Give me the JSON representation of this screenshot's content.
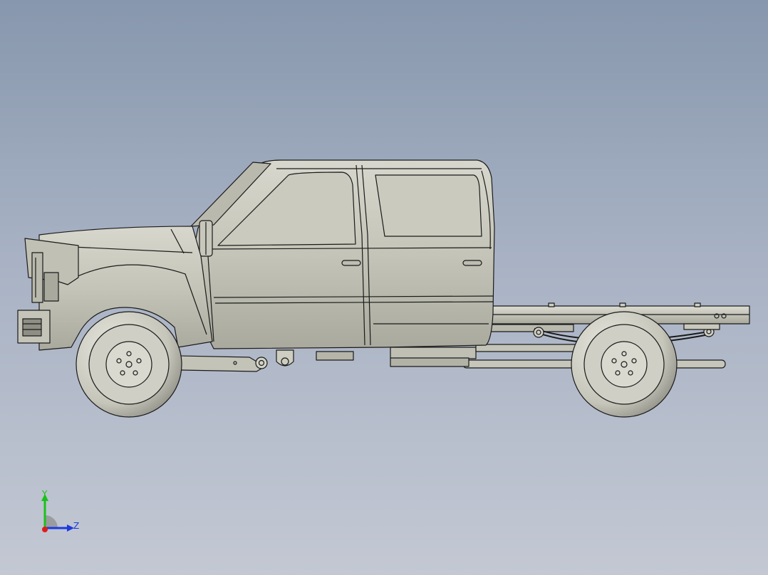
{
  "viewport": {
    "background_top": "#8797ad",
    "background_bottom": "#c3c8d3",
    "model_fill": "#c9c9bf",
    "model_stroke": "#1a1a1a"
  },
  "triad": {
    "y_label": "Y",
    "z_label": "Z",
    "y_color": "#19c219",
    "z_color": "#1b3ae0",
    "x_color": "#e01b1b"
  }
}
